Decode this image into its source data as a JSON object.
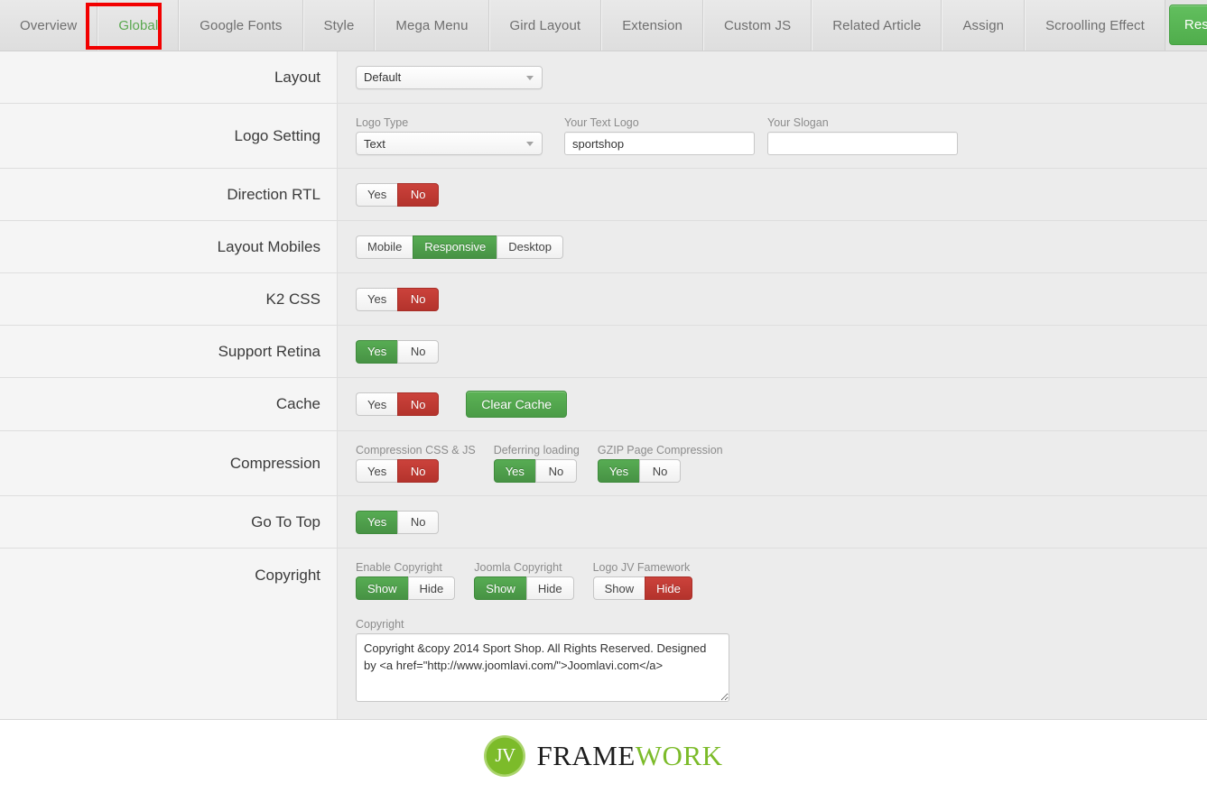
{
  "tabs": [
    {
      "label": "Overview",
      "active": false
    },
    {
      "label": "Global",
      "active": true
    },
    {
      "label": "Google Fonts",
      "active": false
    },
    {
      "label": "Style",
      "active": false
    },
    {
      "label": "Mega Menu",
      "active": false
    },
    {
      "label": "Gird Layout",
      "active": false
    },
    {
      "label": "Extension",
      "active": false
    },
    {
      "label": "Custom JS",
      "active": false
    },
    {
      "label": "Related Article",
      "active": false
    },
    {
      "label": "Assign",
      "active": false
    },
    {
      "label": "Scroolling Effect",
      "active": false
    }
  ],
  "reset_button": {
    "label": "Reset to default"
  },
  "annotation": {
    "color": "#f20000",
    "target_tab": "Global"
  },
  "rows": {
    "layout": {
      "label": "Layout",
      "select_value": "Default"
    },
    "logo_setting": {
      "label": "Logo Setting",
      "logo_type_label": "Logo Type",
      "logo_type_value": "Text",
      "text_logo_label": "Your Text Logo",
      "text_logo_value": "sportshop",
      "slogan_label": "Your Slogan",
      "slogan_value": ""
    },
    "direction_rtl": {
      "label": "Direction RTL",
      "options": [
        "Yes",
        "No"
      ],
      "selected": "No"
    },
    "layout_mobiles": {
      "label": "Layout Mobiles",
      "options": [
        "Mobile",
        "Responsive",
        "Desktop"
      ],
      "selected": "Responsive"
    },
    "k2_css": {
      "label": "K2 CSS",
      "options": [
        "Yes",
        "No"
      ],
      "selected": "No"
    },
    "support_retina": {
      "label": "Support Retina",
      "options": [
        "Yes",
        "No"
      ],
      "selected": "Yes"
    },
    "cache": {
      "label": "Cache",
      "options": [
        "Yes",
        "No"
      ],
      "selected": "No",
      "clear_cache_label": "Clear Cache"
    },
    "compression": {
      "label": "Compression",
      "groups": [
        {
          "title": "Compression CSS & JS",
          "options": [
            "Yes",
            "No"
          ],
          "selected": "No"
        },
        {
          "title": "Deferring loading",
          "options": [
            "Yes",
            "No"
          ],
          "selected": "Yes"
        },
        {
          "title": "GZIP Page Compression",
          "options": [
            "Yes",
            "No"
          ],
          "selected": "Yes"
        }
      ]
    },
    "go_to_top": {
      "label": "Go To Top",
      "options": [
        "Yes",
        "No"
      ],
      "selected": "Yes"
    },
    "copyright": {
      "label": "Copyright",
      "groups": [
        {
          "title": "Enable Copyright",
          "options": [
            "Show",
            "Hide"
          ],
          "selected": "Show"
        },
        {
          "title": "Joomla Copyright",
          "options": [
            "Show",
            "Hide"
          ],
          "selected": "Show"
        },
        {
          "title": "Logo JV Famework",
          "options": [
            "Show",
            "Hide"
          ],
          "selected": "Hide"
        }
      ],
      "textarea_label": "Copyright",
      "textarea_value": "Copyright &copy 2014 Sport Shop. All Rights Reserved. Designed by <a href=\"http://www.joomlavi.com/\">Joomlavi.com</a>"
    }
  },
  "footer": {
    "mark_text": "JV",
    "name_dark": "FRAME",
    "name_green": "WORK"
  },
  "colors": {
    "green": "#51a351",
    "red": "#bd362f",
    "accent_green": "#5aa84f",
    "annotation_red": "#f20000"
  }
}
